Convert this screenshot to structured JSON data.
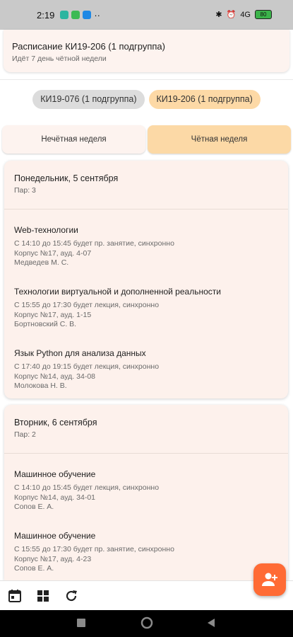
{
  "status_bar": {
    "time": "2:19",
    "more": "··",
    "signal_label": "4G",
    "battery": "80"
  },
  "header": {
    "title": "Расписание КИ19-206 (1 подгруппа)",
    "subtitle": "Идёт 7 день чётной недели"
  },
  "groups": [
    {
      "label": "КИ19-076 (1 подгруппа)",
      "active": false
    },
    {
      "label": "КИ19-206 (1 подгруппа)",
      "active": true
    }
  ],
  "weeks": {
    "odd": "Нечётная неделя",
    "even": "Чётная неделя",
    "selected": "even"
  },
  "days": [
    {
      "title": "Понедельник, 5 сентября",
      "pairs": "Пар: 3",
      "lessons": [
        {
          "name": "Web-технологии",
          "time": "С 14:10 до 15:45 будет пр. занятие, синхронно",
          "room": "Корпус №17, ауд. 4-07",
          "teacher": "Медведев М. С."
        },
        {
          "name": "Технологии виртуальной и дополненной реальности",
          "time": "С 15:55 до 17:30 будет лекция, синхронно",
          "room": "Корпус №17, ауд. 1-15",
          "teacher": "Бортновский С. В."
        },
        {
          "name": "Язык Python для анализа данных",
          "time": "С 17:40 до 19:15 будет лекция, синхронно",
          "room": "Корпус №14, ауд. 34-08",
          "teacher": "Молокова Н. В."
        }
      ]
    },
    {
      "title": "Вторник, 6 сентября",
      "pairs": "Пар: 2",
      "lessons": [
        {
          "name": "Машинное обучение",
          "time": "С 14:10 до 15:45 будет лекция, синхронно",
          "room": "Корпус №14, ауд. 34-01",
          "teacher": "Сопов Е. А."
        },
        {
          "name": "Машинное обучение",
          "time": "С 15:55 до 17:30 будет пр. занятие, синхронно",
          "room": "Корпус №17, ауд. 4-23",
          "teacher": "Сопов Е. А."
        }
      ]
    }
  ],
  "icons": {
    "bottom": [
      "calendar-icon",
      "grid-icon",
      "refresh-icon"
    ],
    "fab": "add-user-icon"
  },
  "colors": {
    "accent": "#ff6b35",
    "chip_active": "#fdd9a6",
    "week_active": "#fcd9a6",
    "card_bg": "#fdf1ec"
  }
}
